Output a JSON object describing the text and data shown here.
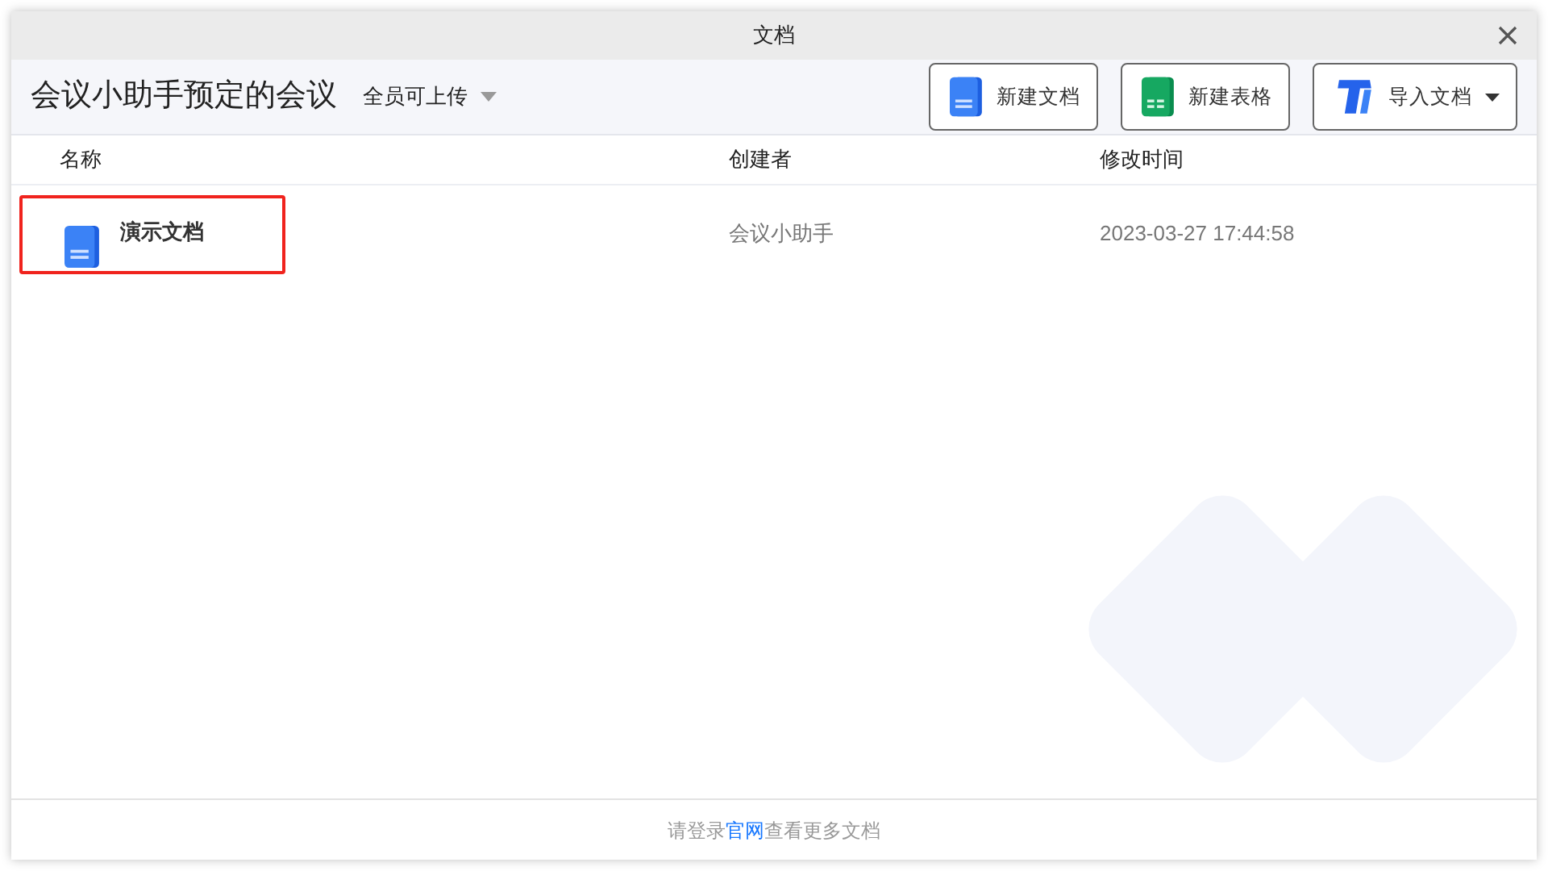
{
  "window": {
    "title": "文档"
  },
  "header": {
    "title": "会议小助手预定的会议",
    "permission": "全员可上传"
  },
  "buttons": [
    {
      "kind": "doc",
      "label": "新建文档",
      "has_menu": false
    },
    {
      "kind": "sheet",
      "label": "新建表格",
      "has_menu": false
    },
    {
      "kind": "import",
      "label": "导入文档",
      "has_menu": true
    }
  ],
  "table": {
    "columns": [
      "名称",
      "创建者",
      "修改时间"
    ],
    "rows": [
      {
        "kind": "doc",
        "name": "演示文档",
        "creator": "会议小助手",
        "modified": "2023-03-27 17:44:58",
        "highlighted": true
      }
    ]
  },
  "footer": {
    "before": "请登录",
    "link": "官网",
    "after": "查看更多文档"
  }
}
